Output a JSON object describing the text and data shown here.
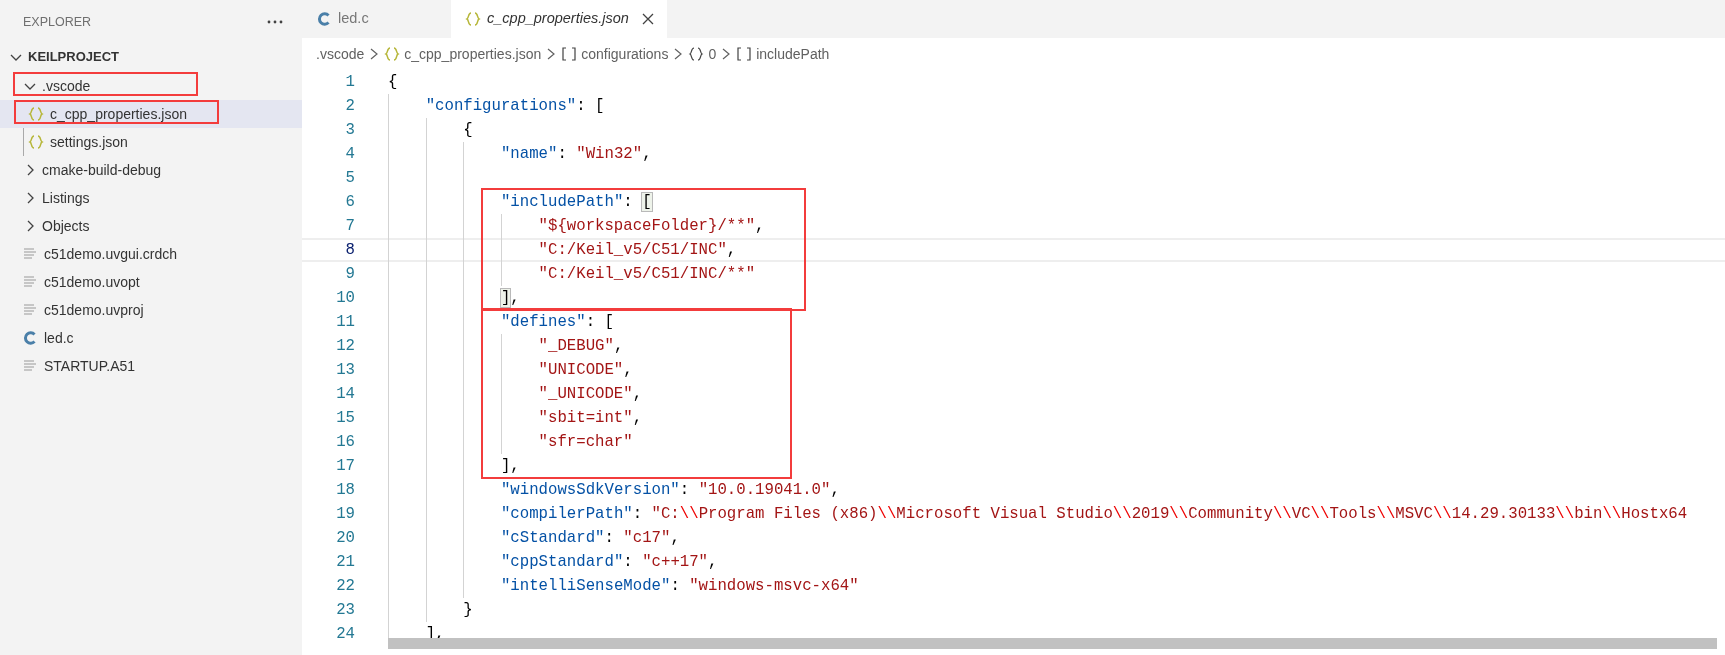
{
  "sidebar": {
    "title": "EXPLORER",
    "tree": [
      {
        "label": "KEILPROJECT",
        "kind": "root",
        "expanded": true,
        "selected": false,
        "children": [
          {
            "label": ".vscode",
            "kind": "folder",
            "expanded": true,
            "selected": false,
            "annotated": true,
            "children": [
              {
                "label": "c_cpp_properties.json",
                "kind": "json",
                "selected": true,
                "annotated": true
              },
              {
                "label": "settings.json",
                "kind": "json",
                "selected": false,
                "annotated": false
              }
            ]
          },
          {
            "label": "cmake-build-debug",
            "kind": "folder",
            "expanded": false,
            "selected": false,
            "annotated": false
          },
          {
            "label": "Listings",
            "kind": "folder",
            "expanded": false,
            "selected": false,
            "annotated": false
          },
          {
            "label": "Objects",
            "kind": "folder",
            "expanded": false,
            "selected": false,
            "annotated": false
          },
          {
            "label": "c51demo.uvgui.crdch",
            "kind": "text",
            "selected": false,
            "annotated": false
          },
          {
            "label": "c51demo.uvopt",
            "kind": "text",
            "selected": false,
            "annotated": false
          },
          {
            "label": "c51demo.uvproj",
            "kind": "text",
            "selected": false,
            "annotated": false
          },
          {
            "label": "led.c",
            "kind": "c",
            "selected": false,
            "annotated": false
          },
          {
            "label": "STARTUP.A51",
            "kind": "text",
            "selected": false,
            "annotated": false
          }
        ]
      }
    ]
  },
  "tabs": [
    {
      "label": "led.c",
      "kind": "c",
      "selected": false
    },
    {
      "label": "c_cpp_properties.json",
      "kind": "json",
      "selected": true
    }
  ],
  "breadcrumb": [
    {
      "label": ".vscode",
      "kind": "folder"
    },
    {
      "label": "c_cpp_properties.json",
      "kind": "json"
    },
    {
      "label": "configurations",
      "kind": "array"
    },
    {
      "label": "0",
      "kind": "object"
    },
    {
      "label": "includePath",
      "kind": "array"
    }
  ],
  "editor": {
    "sections": [
      {
        "annotated": false,
        "lines": [
          {
            "number": "1",
            "current": false,
            "tokens": [
              {
                "kind": "punct",
                "text": "{"
              }
            ]
          },
          {
            "number": "2",
            "current": false,
            "tokens": [
              {
                "kind": "key",
                "text": "\"configurations\""
              },
              {
                "kind": "punct",
                "text": ": ["
              }
            ]
          },
          {
            "number": "3",
            "current": false,
            "tokens": [
              {
                "kind": "punct",
                "text": "{"
              }
            ]
          },
          {
            "number": "4",
            "current": false,
            "tokens": [
              {
                "kind": "key",
                "text": "\"name\""
              },
              {
                "kind": "punct",
                "text": ": "
              },
              {
                "kind": "string",
                "text": "\"Win32\""
              },
              {
                "kind": "punct",
                "text": ","
              }
            ]
          },
          {
            "number": "5",
            "current": false
          }
        ]
      },
      {
        "annotated": true,
        "lines": [
          {
            "number": "6",
            "current": false,
            "tokens": [
              {
                "kind": "key",
                "text": "\"includePath\""
              },
              {
                "kind": "punct",
                "text": ": "
              },
              {
                "kind": "bracket",
                "text": "["
              }
            ]
          },
          {
            "number": "7",
            "current": false,
            "tokens": [
              {
                "kind": "string",
                "text": "\"${workspaceFolder}/**\""
              },
              {
                "kind": "punct",
                "text": ","
              }
            ]
          },
          {
            "number": "8",
            "current": true,
            "tokens": [
              {
                "kind": "string",
                "text": "\"C:/Keil_v5/C51/INC\""
              },
              {
                "kind": "punct",
                "text": ","
              }
            ]
          },
          {
            "number": "9",
            "current": false,
            "tokens": [
              {
                "kind": "string",
                "text": "\"C:/Keil_v5/C51/INC/**\""
              }
            ]
          },
          {
            "number": "10",
            "current": false,
            "tokens": [
              {
                "kind": "bracket",
                "text": "]"
              },
              {
                "kind": "punct",
                "text": ","
              }
            ]
          }
        ]
      },
      {
        "annotated": true,
        "lines": [
          {
            "number": "11",
            "current": false,
            "tokens": [
              {
                "kind": "key",
                "text": "\"defines\""
              },
              {
                "kind": "punct",
                "text": ": ["
              }
            ]
          },
          {
            "number": "12",
            "current": false,
            "tokens": [
              {
                "kind": "string",
                "text": "\"_DEBUG\""
              },
              {
                "kind": "punct",
                "text": ","
              }
            ]
          },
          {
            "number": "13",
            "current": false,
            "tokens": [
              {
                "kind": "string",
                "text": "\"UNICODE\""
              },
              {
                "kind": "punct",
                "text": ","
              }
            ]
          },
          {
            "number": "14",
            "current": false,
            "tokens": [
              {
                "kind": "string",
                "text": "\"_UNICODE\""
              },
              {
                "kind": "punct",
                "text": ","
              }
            ]
          },
          {
            "number": "15",
            "current": false,
            "tokens": [
              {
                "kind": "string",
                "text": "\"sbit=int\""
              },
              {
                "kind": "punct",
                "text": ","
              }
            ]
          },
          {
            "number": "16",
            "current": false,
            "tokens": [
              {
                "kind": "string",
                "text": "\"sfr=char\""
              }
            ]
          },
          {
            "number": "17",
            "current": false,
            "tokens": [
              {
                "kind": "punct",
                "text": "],"
              }
            ]
          }
        ]
      },
      {
        "annotated": false,
        "lines": [
          {
            "number": "18",
            "current": false,
            "tokens": [
              {
                "kind": "key",
                "text": "\"windowsSdkVersion\""
              },
              {
                "kind": "punct",
                "text": ": "
              },
              {
                "kind": "string",
                "text": "\"10.0.19041.0\""
              },
              {
                "kind": "punct",
                "text": ","
              }
            ]
          },
          {
            "number": "19",
            "current": false,
            "tokens": [
              {
                "kind": "key",
                "text": "\"compilerPath\""
              },
              {
                "kind": "punct",
                "text": ": "
              },
              {
                "kind": "string",
                "text": "\"C:"
              },
              {
                "kind": "escape",
                "text": "\\\\"
              },
              {
                "kind": "string",
                "text": "Program Files (x86)"
              },
              {
                "kind": "escape",
                "text": "\\\\"
              },
              {
                "kind": "string",
                "text": "Microsoft Visual Studio"
              },
              {
                "kind": "escape",
                "text": "\\\\"
              },
              {
                "kind": "string",
                "text": "2019"
              },
              {
                "kind": "escape",
                "text": "\\\\"
              },
              {
                "kind": "string",
                "text": "Community"
              },
              {
                "kind": "escape",
                "text": "\\\\"
              },
              {
                "kind": "string",
                "text": "VC"
              },
              {
                "kind": "escape",
                "text": "\\\\"
              },
              {
                "kind": "string",
                "text": "Tools"
              },
              {
                "kind": "escape",
                "text": "\\\\"
              },
              {
                "kind": "string",
                "text": "MSVC"
              },
              {
                "kind": "escape",
                "text": "\\\\"
              },
              {
                "kind": "string",
                "text": "14.29.30133"
              },
              {
                "kind": "escape",
                "text": "\\\\"
              },
              {
                "kind": "string",
                "text": "bin"
              },
              {
                "kind": "escape",
                "text": "\\\\"
              },
              {
                "kind": "string",
                "text": "Hostx64"
              }
            ]
          },
          {
            "number": "20",
            "current": false,
            "tokens": [
              {
                "kind": "key",
                "text": "\"cStandard\""
              },
              {
                "kind": "punct",
                "text": ": "
              },
              {
                "kind": "string",
                "text": "\"c17\""
              },
              {
                "kind": "punct",
                "text": ","
              }
            ]
          },
          {
            "number": "21",
            "current": false,
            "tokens": [
              {
                "kind": "key",
                "text": "\"cppStandard\""
              },
              {
                "kind": "punct",
                "text": ": "
              },
              {
                "kind": "string",
                "text": "\"c++17\""
              },
              {
                "kind": "punct",
                "text": ","
              }
            ]
          },
          {
            "number": "22",
            "current": false,
            "tokens": [
              {
                "kind": "key",
                "text": "\"intelliSenseMode\""
              },
              {
                "kind": "punct",
                "text": ": "
              },
              {
                "kind": "string",
                "text": "\"windows-msvc-x64\""
              }
            ]
          },
          {
            "number": "23",
            "current": false,
            "tokens": [
              {
                "kind": "punct",
                "text": "}"
              }
            ]
          },
          {
            "number": "24",
            "current": false,
            "tokens": [
              {
                "kind": "punct",
                "text": "],"
              }
            ]
          }
        ]
      }
    ]
  }
}
